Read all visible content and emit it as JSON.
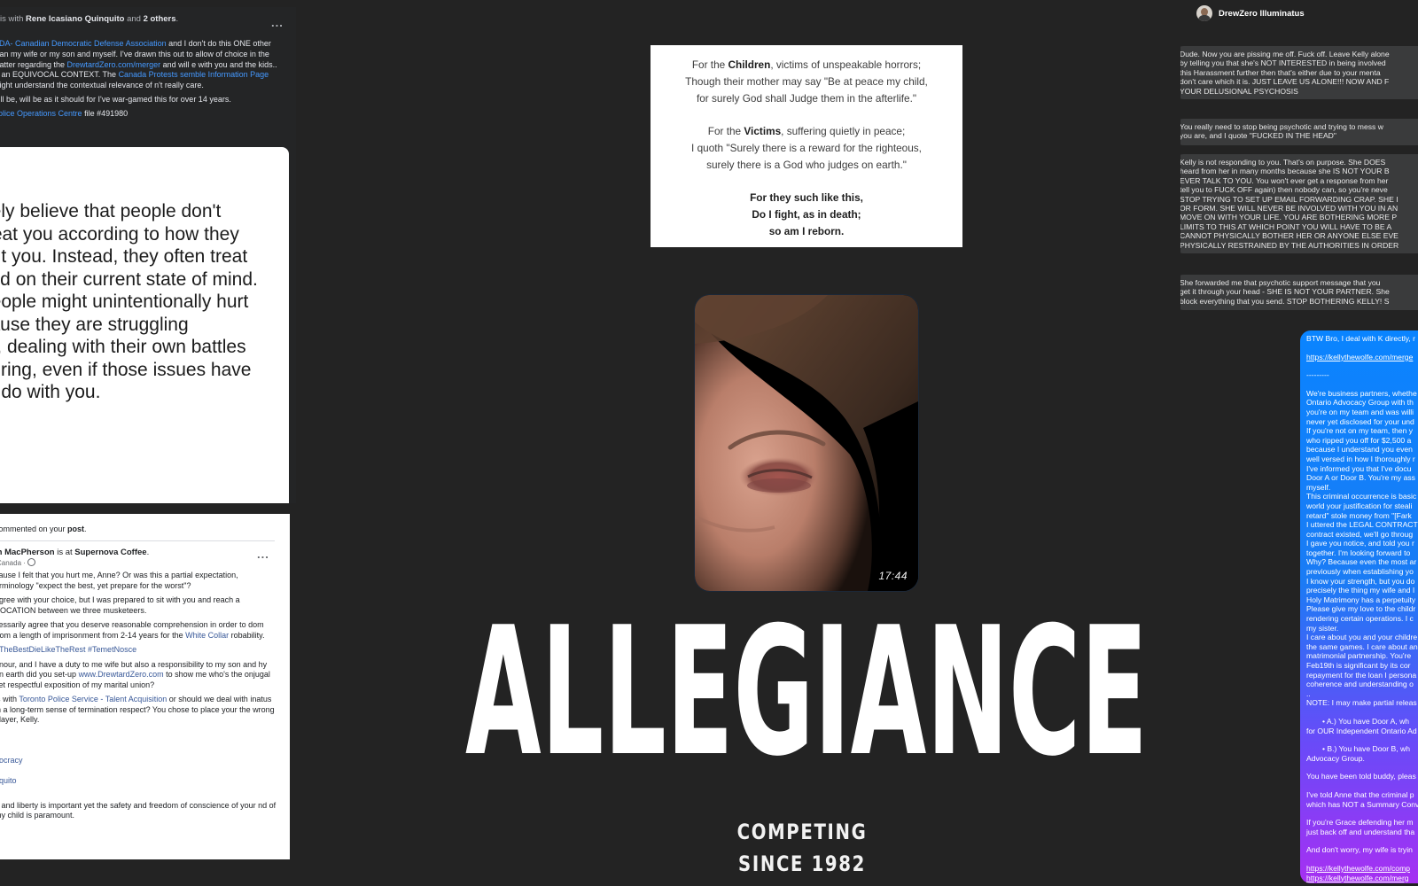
{
  "fb_top": {
    "with_prefix": "is with",
    "with_name": "Rene Icasiano Quinquito",
    "with_and": "and",
    "with_others": "2 others",
    "with_end": ".",
    "more_label": "...",
    "p1_link1": "ODA- Canadian Democratic Defense Association",
    "p1_text1": " and I don't do this ONE other than my wife or my son and myself. I've drawn this out to allow of choice in the matter regarding the ",
    "p1_link2": "DrewtardZero.com/merger",
    "p1_text2": " and will e with you and the kids.. in an EQUIVOCAL CONTEXT. The ",
    "p1_link3": "Canada Protests semble Information Page",
    "p1_text3": " might understand the contextual relevance of n't really care.",
    "p2": "will be, will be as it should for I've war-gamed this for over 14 years.",
    "p3_link": "Police Operations Centre",
    "p3_text": " file #491980",
    "quote_lines": [
      "nely believe that people don't",
      "treat you according to how they",
      "out you. Instead, they often treat",
      "sed on their current state of mind.",
      "people might unintentionally hurt",
      "cause they are struggling",
      "lly, dealing with their own battles",
      "ffering, even if those issues have",
      "to do with you."
    ]
  },
  "fb_bot": {
    "sub_text": "commented on your ",
    "sub_bold": "post",
    "sub_end": ".",
    "author_name": "m MacPherson",
    "author_mid": " is at ",
    "author_place": "Supernova Coffee",
    "author_end": ".",
    "location": "Canada · ",
    "more_label": "...",
    "p1": "cause I felt that you hurt me, Anne? Or was this a partial expectation, erminology \"expect the best, yet prepare for the worst\"?",
    "p2": "agree with your choice, but I was prepared to sit with you and reach a VOCATION between we three musketeers.",
    "p3_text": "cessarily agree that you deserve reasonable comprehension in order to dom from a length of imprisonment from 2-14 years for the ",
    "p3_link": "White Collar",
    "p3_end": " robability.",
    "p4_link": "nTheBestDieLikeTheRest #TemetNosce",
    "p5_text": "onour, and I have a duty to me wife but also a responsibility to my son and hy on earth did you set-up ",
    "p5_link": "www.DrewtardZero.com",
    "p5_end": " to show me who's the onjugal yet respectful exposition of my marital union?",
    "p6_text": "is with ",
    "p6_link": "Toronto Police Service - Talent Acquisition",
    "p6_end": " or should we deal with inatus in a long-term sense of termination respect? You chose to place your the wrong player, Kelly.",
    "link_a": "nocracy",
    "link_b": "nquito",
    "p7": "g and liberty is important yet the safety and freedom of conscience of your nd of my child is paramount."
  },
  "poem": {
    "s1_l1_pre": "For the ",
    "s1_l1_bold": "Children",
    "s1_l1_post": ", victims of unspeakable horrors;",
    "s1_l2": "Though their mother may say \"Be at peace my child,",
    "s1_l3": "for surely God shall Judge them in the afterlife.\"",
    "s2_l1_pre": "For the ",
    "s2_l1_bold": "Victims",
    "s2_l1_post": ", suffering quietly in peace;",
    "s2_l2": "I quoth \"Surely there is a reward for the righteous,",
    "s2_l3": "surely there is a God who judges on earth.\"",
    "s3_l1": "For they such like this,",
    "s3_l2": "Do I fight, as in death;",
    "s3_l3": "so am I reborn."
  },
  "photo": {
    "timestamp": "17:44"
  },
  "title": {
    "main": "ALLEGIANCE",
    "tag_line1": "COMPETING",
    "tag_line2": "SINCE 1982"
  },
  "messenger": {
    "contact_name": "DrewZero Illuminatus",
    "bubble1": [
      "Dude. Now you are pissing me off. Fuck off. Leave Kelly alone",
      "by telling you that she's NOT INTERESTED in being involved",
      "this Harassment further then that's either due to your menta",
      "don't care which it is. JUST LEAVE US ALONE!!! NOW AND F",
      "YOUR DELUSIONAL PSYCHOSIS"
    ],
    "bubble2": [
      "You really need to stop being psychotic and trying to mess w",
      "you are, and I quote \"FUCKED IN THE HEAD\""
    ],
    "bubble3": [
      "Kelly is not responding to you. That's on purpose. She DOES",
      "heard from her in many months because she IS NOT YOUR B",
      "EVER TALK TO YOU. You won't ever get a response from her",
      "tell you to FUCK OFF again) then nobody can, so you're neve",
      "STOP TRYING TO SET UP EMAIL FORWARDING CRAP. SHE I",
      "OR FORM. SHE WILL NEVER BE INVOLVED WITH YOU IN AN",
      "MOVE ON WITH YOUR LIFE. YOU ARE BOTHERING MORE P",
      "LIMITS TO THIS AT WHICH POINT YOU WILL HAVE TO BE A",
      "CANNOT PHYSICALLY BOTHER HER OR ANYONE ELSE EVE",
      "PHYSICALLY RESTRAINED BY THE AUTHORITIES IN ORDER"
    ],
    "bubble4": [
      "She forwarded me that psychotic support message that you",
      "get it through your head - SHE IS NOT YOUR PARTNER. She",
      "block everything that you send. STOP BOTHERING KELLY! S"
    ],
    "blue_l1": "BTW Bro, I deal with K directly, r",
    "blue_link1": "https://kellythewolfe.com/merge",
    "blue_dash": "---------",
    "blue_block": [
      "We're business partners, whethe",
      "Ontario Advocacy Group with th",
      "you're on my team and was willi",
      "never yet disclosed for your und",
      "If you're not on my team, then y",
      "who ripped you off for $2,500 a",
      "because I understand you even",
      "well versed in how I thoroughly r",
      "I've informed you that I've docu",
      "Door A or Door B. You're my ass",
      "myself.",
      "This criminal occurrence is basic",
      "world your justification for steali",
      "retard\" stole money from \"[Fark",
      "I uttered the LEGAL CONTRACT",
      "contract existed, we'll go throug",
      "I gave you notice, and told you r",
      "together. I'm looking forward to",
      "Why? Because even the most ar",
      "previously when establishing yo",
      "I know your strength, but you do",
      "precisely the thing my wife and I",
      "Holy Matrimony has a perpetuity",
      "Please give my love to the childr",
      "rendering certain operations. I c",
      "my sister.",
      "I care about you and your childre",
      "the same games. I care about an",
      "matrimonial partnership. You're",
      "Feb19th is significant by its cor",
      "repayment for the loan I persona",
      "coherence and understanding o",
      "..",
      "NOTE: I may make partial releas"
    ],
    "blue_a1": "•      A.) You have Door A, wh",
    "blue_a2": "for OUR Independent Ontario Ad",
    "blue_b1": "•      B.) You have Door B, wh",
    "blue_b2": "Advocacy Group.",
    "blue_told": "You have been told buddy, pleas",
    "blue_anne1": "I've told Anne that the criminal p",
    "blue_anne2": "which has NOT a Summary Conv",
    "blue_grace1": "If you're Grace defending her m",
    "blue_grace2": "just back off and understand tha",
    "blue_wife": "And don't worry, my wife is tryin",
    "blue_link2": "https://kellythewolfe.com/comp",
    "blue_link3": "https://kellythewolfe.com/merg"
  }
}
